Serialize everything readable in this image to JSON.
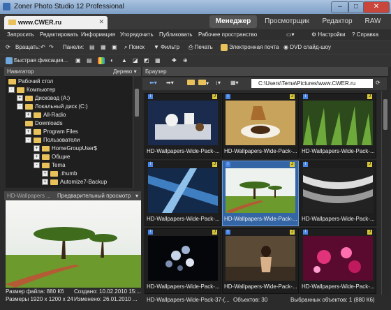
{
  "window": {
    "title": "Zoner Photo Studio 12 Professional"
  },
  "tabs": {
    "document": "www.CWER.ru",
    "modes": [
      "Менеджер",
      "Просмотрщик",
      "Редактор",
      "RAW"
    ]
  },
  "menu": {
    "left": [
      "Запросить",
      "Редактировать",
      "Информация",
      "Упорядочить",
      "Публиковать",
      "Рабочее пространство"
    ],
    "settings": "Настройки",
    "help": "Справка"
  },
  "toolbar1": {
    "rotate": "Вращать:",
    "panels": "Панели:",
    "search": "Поиск",
    "filter": "Фильтр",
    "print": "Печать",
    "email": "Электронная почта",
    "dvd": "DVD слайд-шоу"
  },
  "toolbar2": {
    "quick_fix": "Быстрая фиксация..."
  },
  "navigator": {
    "title": "Навигатор",
    "view": "Дерево",
    "tree": [
      {
        "label": "Рабочий стол",
        "level": 0,
        "exp": ""
      },
      {
        "label": "Компьютер",
        "level": 0,
        "exp": "-"
      },
      {
        "label": "Дисковод (A:)",
        "level": 1,
        "exp": "+"
      },
      {
        "label": "Локальный диск (C:)",
        "level": 1,
        "exp": "-"
      },
      {
        "label": "All-Radio",
        "level": 2,
        "exp": "+"
      },
      {
        "label": "Downloads",
        "level": 2,
        "exp": ""
      },
      {
        "label": "Program Files",
        "level": 2,
        "exp": "+"
      },
      {
        "label": "Пользователи",
        "level": 2,
        "exp": "-"
      },
      {
        "label": "HomeGroupUser$",
        "level": 3,
        "exp": "+"
      },
      {
        "label": "Общие",
        "level": 3,
        "exp": "+"
      },
      {
        "label": "Tema",
        "level": 3,
        "exp": "-"
      },
      {
        "label": ".thumb",
        "level": 4,
        "exp": "+"
      },
      {
        "label": "Automize7-Backup",
        "level": 4,
        "exp": "+"
      }
    ]
  },
  "preview": {
    "tab_name": "HD-Wallpapers ...",
    "title": "Предварительный просмотр",
    "file_size": "Размер файла: 880 К6",
    "created": "Создано: 10.02.2010 15:...",
    "dimensions": "Размеры 1920 x 1200 x 24",
    "modified": "Изменено: 26.01.2010 ..."
  },
  "browser": {
    "title": "Браузер",
    "path": "C:\\Users\\Tema\\Pictures\\www.CWER.ru",
    "thumbs": [
      {
        "caption": "HD-Wallpapers-Wide-Pack-...",
        "selected": false,
        "scene": "table"
      },
      {
        "caption": "HD-Wallpapers-Wide-Pack-...",
        "selected": false,
        "scene": "coffee"
      },
      {
        "caption": "HD-Wallpapers-Wide-Pack-...",
        "selected": false,
        "scene": "grass"
      },
      {
        "caption": "HD-Wallpapers-Wide-Pack-...",
        "selected": false,
        "scene": "blue"
      },
      {
        "caption": "HD-Wallpapers-Wide-Pack-...",
        "selected": true,
        "scene": "savanna"
      },
      {
        "caption": "HD-Wallpapers-Wide-Pack-...",
        "selected": false,
        "scene": "arch"
      },
      {
        "caption": "HD-Wallpapers-Wide-Pack-...",
        "selected": false,
        "scene": "bokeh"
      },
      {
        "caption": "HD-Wallpapers-Wide-Pack-...",
        "selected": false,
        "scene": "woman"
      },
      {
        "caption": "HD-Wallpapers-Wide-Pack-...",
        "selected": false,
        "scene": "hearts"
      }
    ]
  },
  "status": {
    "file": "HD-Wallpapers-Wide-Pack-37-(...",
    "objects": "Объектов: 30",
    "selected": "Выбранных объектов: 1 (880 К6)"
  },
  "colors": {
    "accent": "#3465a4",
    "folder": "#e8c15a",
    "background": "#2b2b2b"
  }
}
